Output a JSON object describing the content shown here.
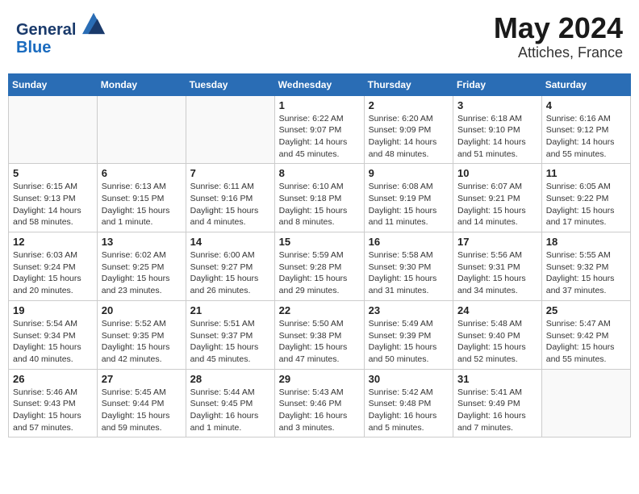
{
  "header": {
    "logo_general": "General",
    "logo_blue": "Blue",
    "title": "May 2024",
    "subtitle": "Attiches, France"
  },
  "calendar": {
    "days_of_week": [
      "Sunday",
      "Monday",
      "Tuesday",
      "Wednesday",
      "Thursday",
      "Friday",
      "Saturday"
    ],
    "weeks": [
      [
        {
          "day": "",
          "info": ""
        },
        {
          "day": "",
          "info": ""
        },
        {
          "day": "",
          "info": ""
        },
        {
          "day": "1",
          "info": "Sunrise: 6:22 AM\nSunset: 9:07 PM\nDaylight: 14 hours\nand 45 minutes."
        },
        {
          "day": "2",
          "info": "Sunrise: 6:20 AM\nSunset: 9:09 PM\nDaylight: 14 hours\nand 48 minutes."
        },
        {
          "day": "3",
          "info": "Sunrise: 6:18 AM\nSunset: 9:10 PM\nDaylight: 14 hours\nand 51 minutes."
        },
        {
          "day": "4",
          "info": "Sunrise: 6:16 AM\nSunset: 9:12 PM\nDaylight: 14 hours\nand 55 minutes."
        }
      ],
      [
        {
          "day": "5",
          "info": "Sunrise: 6:15 AM\nSunset: 9:13 PM\nDaylight: 14 hours\nand 58 minutes."
        },
        {
          "day": "6",
          "info": "Sunrise: 6:13 AM\nSunset: 9:15 PM\nDaylight: 15 hours\nand 1 minute."
        },
        {
          "day": "7",
          "info": "Sunrise: 6:11 AM\nSunset: 9:16 PM\nDaylight: 15 hours\nand 4 minutes."
        },
        {
          "day": "8",
          "info": "Sunrise: 6:10 AM\nSunset: 9:18 PM\nDaylight: 15 hours\nand 8 minutes."
        },
        {
          "day": "9",
          "info": "Sunrise: 6:08 AM\nSunset: 9:19 PM\nDaylight: 15 hours\nand 11 minutes."
        },
        {
          "day": "10",
          "info": "Sunrise: 6:07 AM\nSunset: 9:21 PM\nDaylight: 15 hours\nand 14 minutes."
        },
        {
          "day": "11",
          "info": "Sunrise: 6:05 AM\nSunset: 9:22 PM\nDaylight: 15 hours\nand 17 minutes."
        }
      ],
      [
        {
          "day": "12",
          "info": "Sunrise: 6:03 AM\nSunset: 9:24 PM\nDaylight: 15 hours\nand 20 minutes."
        },
        {
          "day": "13",
          "info": "Sunrise: 6:02 AM\nSunset: 9:25 PM\nDaylight: 15 hours\nand 23 minutes."
        },
        {
          "day": "14",
          "info": "Sunrise: 6:00 AM\nSunset: 9:27 PM\nDaylight: 15 hours\nand 26 minutes."
        },
        {
          "day": "15",
          "info": "Sunrise: 5:59 AM\nSunset: 9:28 PM\nDaylight: 15 hours\nand 29 minutes."
        },
        {
          "day": "16",
          "info": "Sunrise: 5:58 AM\nSunset: 9:30 PM\nDaylight: 15 hours\nand 31 minutes."
        },
        {
          "day": "17",
          "info": "Sunrise: 5:56 AM\nSunset: 9:31 PM\nDaylight: 15 hours\nand 34 minutes."
        },
        {
          "day": "18",
          "info": "Sunrise: 5:55 AM\nSunset: 9:32 PM\nDaylight: 15 hours\nand 37 minutes."
        }
      ],
      [
        {
          "day": "19",
          "info": "Sunrise: 5:54 AM\nSunset: 9:34 PM\nDaylight: 15 hours\nand 40 minutes."
        },
        {
          "day": "20",
          "info": "Sunrise: 5:52 AM\nSunset: 9:35 PM\nDaylight: 15 hours\nand 42 minutes."
        },
        {
          "day": "21",
          "info": "Sunrise: 5:51 AM\nSunset: 9:37 PM\nDaylight: 15 hours\nand 45 minutes."
        },
        {
          "day": "22",
          "info": "Sunrise: 5:50 AM\nSunset: 9:38 PM\nDaylight: 15 hours\nand 47 minutes."
        },
        {
          "day": "23",
          "info": "Sunrise: 5:49 AM\nSunset: 9:39 PM\nDaylight: 15 hours\nand 50 minutes."
        },
        {
          "day": "24",
          "info": "Sunrise: 5:48 AM\nSunset: 9:40 PM\nDaylight: 15 hours\nand 52 minutes."
        },
        {
          "day": "25",
          "info": "Sunrise: 5:47 AM\nSunset: 9:42 PM\nDaylight: 15 hours\nand 55 minutes."
        }
      ],
      [
        {
          "day": "26",
          "info": "Sunrise: 5:46 AM\nSunset: 9:43 PM\nDaylight: 15 hours\nand 57 minutes."
        },
        {
          "day": "27",
          "info": "Sunrise: 5:45 AM\nSunset: 9:44 PM\nDaylight: 15 hours\nand 59 minutes."
        },
        {
          "day": "28",
          "info": "Sunrise: 5:44 AM\nSunset: 9:45 PM\nDaylight: 16 hours\nand 1 minute."
        },
        {
          "day": "29",
          "info": "Sunrise: 5:43 AM\nSunset: 9:46 PM\nDaylight: 16 hours\nand 3 minutes."
        },
        {
          "day": "30",
          "info": "Sunrise: 5:42 AM\nSunset: 9:48 PM\nDaylight: 16 hours\nand 5 minutes."
        },
        {
          "day": "31",
          "info": "Sunrise: 5:41 AM\nSunset: 9:49 PM\nDaylight: 16 hours\nand 7 minutes."
        },
        {
          "day": "",
          "info": ""
        }
      ]
    ]
  }
}
